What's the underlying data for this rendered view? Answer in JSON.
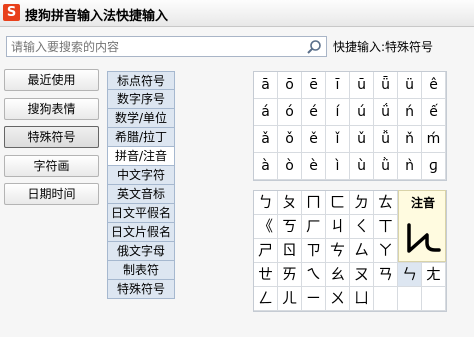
{
  "app": {
    "logo": "S",
    "title": "搜狗拼音输入法快捷输入"
  },
  "search": {
    "placeholder": "请输入要搜索的内容",
    "icon": "search-icon"
  },
  "breadcrumb": "快捷输入:特殊符号",
  "left_nav": [
    "最近使用",
    "搜狗表情",
    "特殊符号",
    "字符画",
    "日期时间"
  ],
  "left_nav_active": "特殊符号",
  "categories": [
    "标点符号",
    "数字序号",
    "数学/单位",
    "希腊/拉丁",
    "拼音/注音",
    "中文字符",
    "英文音标",
    "日文平假名",
    "日文片假名",
    "俄文字母",
    "制表符",
    "特殊符号"
  ],
  "category_active": "拼音/注音",
  "pinyin_grid": [
    [
      "ā",
      "ō",
      "ē",
      "ī",
      "ū",
      "ǖ",
      "ü",
      "ê"
    ],
    [
      "á",
      "ó",
      "é",
      "í",
      "ú",
      "ǘ",
      "ń",
      "ế"
    ],
    [
      "ǎ",
      "ǒ",
      "ě",
      "ǐ",
      "ǔ",
      "ǚ",
      "ň",
      "ḿ"
    ],
    [
      "à",
      "ò",
      "è",
      "ì",
      "ù",
      "ǜ",
      "ǹ",
      "ɡ"
    ]
  ],
  "zhuyin_grid": [
    [
      "ㄅ",
      "ㄆ",
      "ㄇ",
      "ㄈ",
      "ㄉ",
      "ㄊ"
    ],
    [
      "《",
      "ㄎ",
      "ㄏ",
      "ㄐ",
      "ㄑ",
      "ㄒ"
    ],
    [
      "ㄕ",
      "ㄖ",
      "ㄗ",
      "ㄘ",
      "ㄙ",
      "ㄚ"
    ],
    [
      "ㄝ",
      "ㄞ",
      "ㄟ",
      "ㄠ",
      "ㄡ",
      "ㄢ",
      "ㄣ",
      "ㄤ"
    ],
    [
      "ㄥ",
      "ㄦ",
      "ㄧ",
      "ㄨ",
      "ㄩ",
      "",
      "",
      ""
    ]
  ],
  "zhuyin_selected": "ㄣ",
  "preview": {
    "label": "注音",
    "glyph": "ㄣ"
  }
}
